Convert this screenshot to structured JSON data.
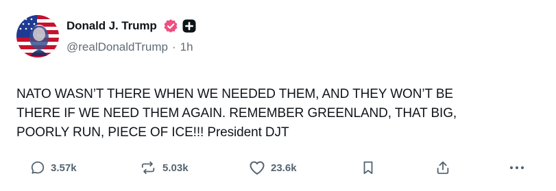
{
  "post": {
    "author": {
      "display_name": "Donald J. Trump",
      "handle": "@realDonaldTrump",
      "separator": "·",
      "time_ago": "1h",
      "verified_color": "#ee4f80"
    },
    "body_lines": [
      "NATO WASN’T THERE WHEN WE NEEDED THEM, AND THEY WON’T BE",
      "THERE IF WE NEED THEM AGAIN. REMEMBER GREENLAND, THAT BIG,",
      "POORLY RUN, PIECE OF ICE!!! President DJT"
    ],
    "actions": {
      "replies": {
        "icon": "comment-icon",
        "count": "3.57k"
      },
      "reposts": {
        "icon": "repost-icon",
        "count": "5.03k"
      },
      "likes": {
        "icon": "heart-icon",
        "count": "23.6k"
      },
      "bookmark": {
        "icon": "bookmark-icon"
      },
      "share": {
        "icon": "share-icon"
      },
      "more": {
        "icon": "more-icon"
      }
    }
  }
}
